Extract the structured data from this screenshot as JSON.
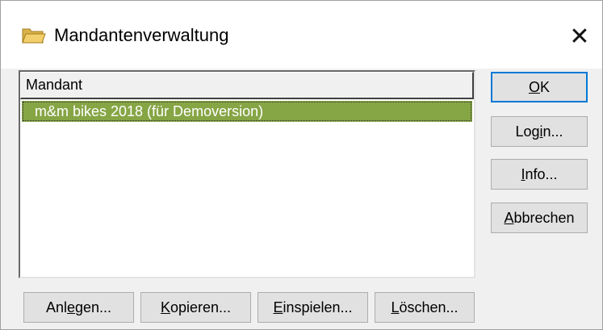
{
  "window": {
    "title": "Mandantenverwaltung",
    "close_glyph": "✕",
    "icon": "folder-icon",
    "accent_color": "#86a545"
  },
  "list": {
    "column_header": "Mandant",
    "rows": [
      {
        "name": "m&m bikes 2018 (für Demoversion)",
        "selected": true
      }
    ]
  },
  "buttons": {
    "ok": {
      "pre": "",
      "mnemonic": "O",
      "post": "K"
    },
    "login": {
      "pre": "Log",
      "mnemonic": "i",
      "post": "n..."
    },
    "info": {
      "pre": "",
      "mnemonic": "I",
      "post": "nfo..."
    },
    "abbrechen": {
      "pre": "",
      "mnemonic": "A",
      "post": "bbrechen"
    },
    "anlegen": {
      "pre": "Anl",
      "mnemonic": "e",
      "post": "gen..."
    },
    "kopieren": {
      "pre": "",
      "mnemonic": "K",
      "post": "opieren..."
    },
    "einspielen": {
      "pre": "",
      "mnemonic": "E",
      "post": "inspielen..."
    },
    "loeschen": {
      "pre": "",
      "mnemonic": "L",
      "post": "öschen..."
    }
  }
}
